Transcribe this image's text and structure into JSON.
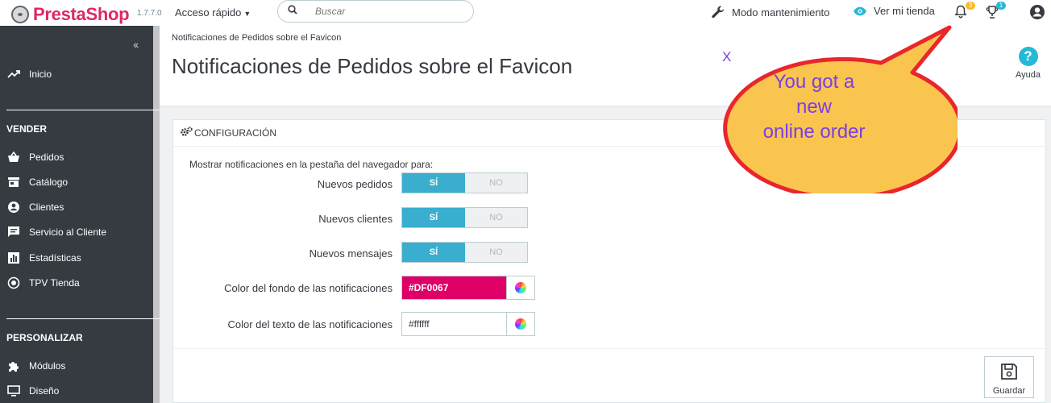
{
  "topbar": {
    "brand_name": "PrestaShop",
    "version": "1.7.7.0",
    "quick_access_label": "Acceso rápido",
    "search_placeholder": "Buscar",
    "maintenance_label": "Modo mantenimiento",
    "view_store_label": "Ver mi tienda",
    "notifications_count": "3",
    "trophy_count": "1",
    "icons": [
      "wrench-icon",
      "eye-icon",
      "bell-icon",
      "trophy-icon",
      "user-icon"
    ]
  },
  "sidebar": {
    "collapse_glyph": "‹‹",
    "home": "Inicio",
    "sections": [
      {
        "title": "VENDER",
        "items": [
          "Pedidos",
          "Catálogo",
          "Clientes",
          "Servicio al Cliente",
          "Estadísticas",
          "TPV Tienda"
        ]
      },
      {
        "title": "PERSONALIZAR",
        "items": [
          "Módulos",
          "Diseño"
        ]
      }
    ]
  },
  "header": {
    "breadcrumb": "Notificaciones de Pedidos sobre el Favicon",
    "title": "Notificaciones de Pedidos sobre el Favicon",
    "help_label": "Ayuda",
    "help_glyph": "?"
  },
  "overlay": {
    "close_glyph": "X",
    "bubble_lines": [
      "You got a",
      "new",
      "online order"
    ],
    "bubble_fill": "#f9c54f",
    "bubble_stroke": "#e8262c",
    "text_color": "#7b3fe4"
  },
  "panel": {
    "heading": "CONFIGURACIÓN",
    "intro": "Mostrar notificaciones en la pestaña del navegador para:",
    "toggles": [
      {
        "label": "Nuevos pedidos",
        "on": "SÍ",
        "off": "NO"
      },
      {
        "label": "Nuevos clientes",
        "on": "SÍ",
        "off": "NO"
      },
      {
        "label": "Nuevos mensajes",
        "on": "SÍ",
        "off": "NO"
      }
    ],
    "bg_color_label": "Color del fondo de las notificaciones",
    "bg_color_value": "#DF0067",
    "text_color_label": "Color del texto de las notificaciones",
    "text_color_value": "#ffffff",
    "save_label": "Guardar"
  },
  "colors": {
    "accent": "#25b9d7",
    "switch_on": "#39aece",
    "brand": "#dc2867",
    "sidebar_bg": "#363a41"
  }
}
